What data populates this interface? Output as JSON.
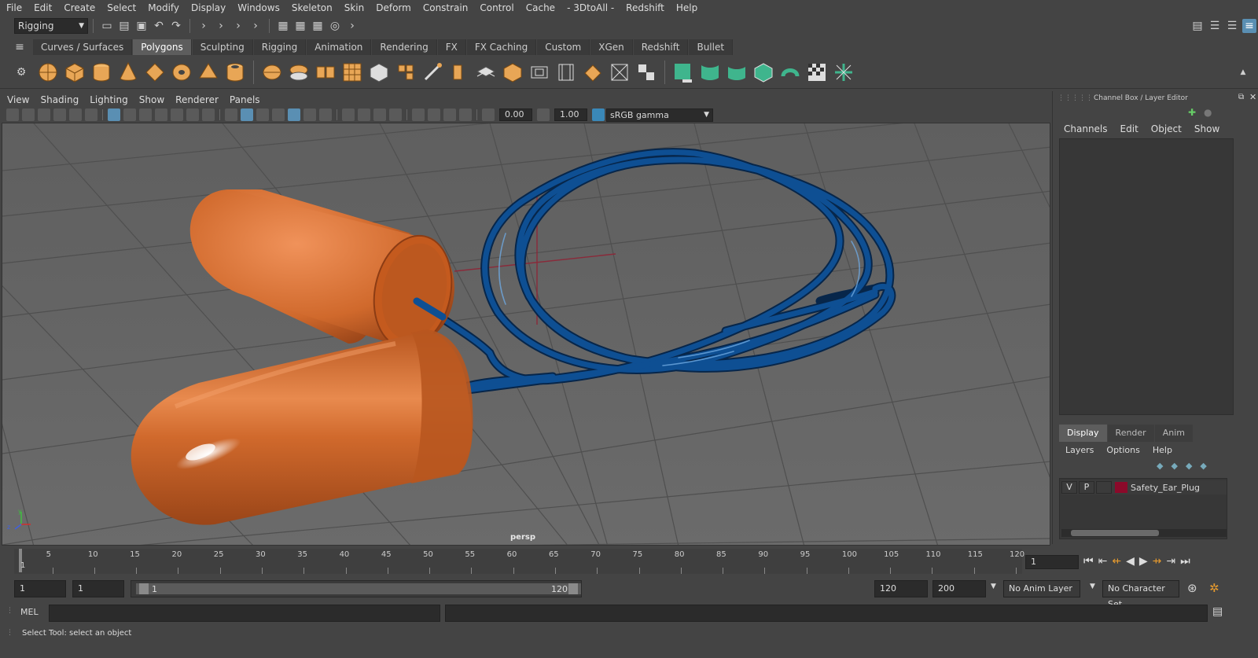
{
  "menubar": [
    "File",
    "Edit",
    "Create",
    "Select",
    "Modify",
    "Display",
    "Windows",
    "Skeleton",
    "Skin",
    "Deform",
    "Constrain",
    "Control",
    "Cache",
    "- 3DtoAll -",
    "Redshift",
    "Help"
  ],
  "statusline": {
    "mode": "Rigging"
  },
  "shelf": {
    "tabs": [
      "Curves / Surfaces",
      "Polygons",
      "Sculpting",
      "Rigging",
      "Animation",
      "Rendering",
      "FX",
      "FX Caching",
      "Custom",
      "XGen",
      "Redshift",
      "Bullet"
    ],
    "active_tab": "Polygons"
  },
  "viewport": {
    "menu": [
      "View",
      "Shading",
      "Lighting",
      "Show",
      "Renderer",
      "Panels"
    ],
    "exposure": "0.00",
    "gamma": "1.00",
    "color_space": "sRGB gamma",
    "camera": "persp"
  },
  "right_panel": {
    "title": "Channel Box / Layer Editor",
    "channel_menu": [
      "Channels",
      "Edit",
      "Object",
      "Show"
    ],
    "layer_tabs": [
      "Display",
      "Render",
      "Anim"
    ],
    "active_layer_tab": "Display",
    "layer_menu": [
      "Layers",
      "Options",
      "Help"
    ],
    "layer": {
      "v": "V",
      "p": "P",
      "name": "Safety_Ear_Plug",
      "color": "#8b0a2a"
    }
  },
  "timeline": {
    "ticks": [
      "5",
      "10",
      "15",
      "20",
      "25",
      "30",
      "35",
      "40",
      "45",
      "50",
      "55",
      "60",
      "65",
      "70",
      "75",
      "80",
      "85",
      "90",
      "95",
      "100",
      "105",
      "110",
      "115",
      "120"
    ],
    "start_marker": "1",
    "current_frame": "1"
  },
  "range": {
    "start": "1",
    "playback_start": "1",
    "slider_start": "1",
    "slider_end": "120",
    "playback_end": "120",
    "end": "200",
    "anim_layer": "No Anim Layer",
    "character_set": "No Character Set"
  },
  "command": {
    "lang": "MEL"
  },
  "help_line": "Select Tool: select an object",
  "colors": {
    "earplug": "#d0692c",
    "cord": "#0e3f78",
    "grid": "#5a5a5a"
  }
}
